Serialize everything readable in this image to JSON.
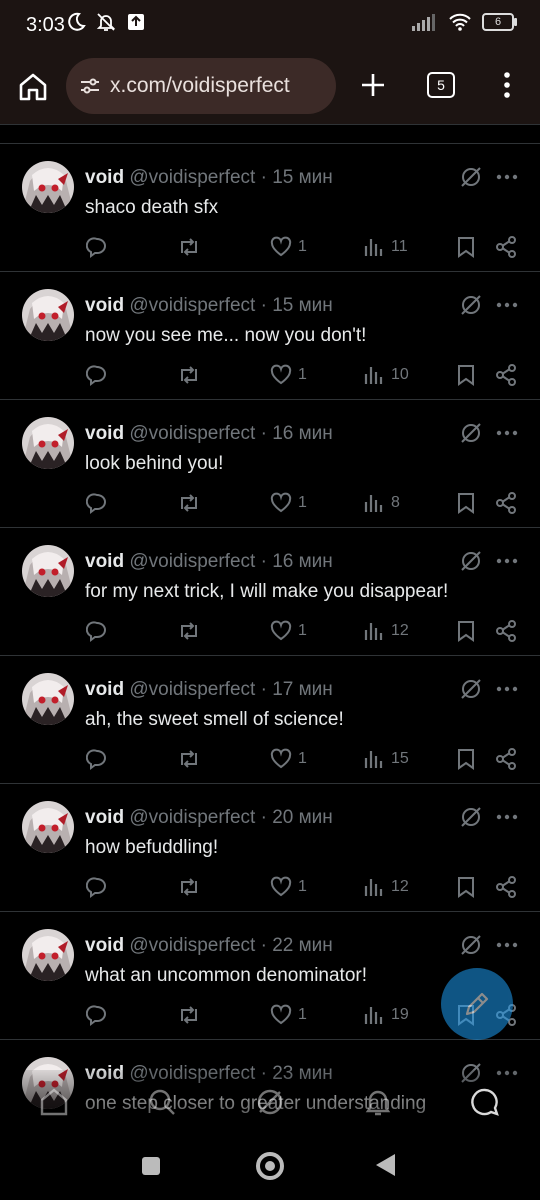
{
  "status_bar": {
    "time": "3:03",
    "battery": "6"
  },
  "browser": {
    "url": "x.com/voidisperfect",
    "tab_count": "5"
  },
  "tweets": [
    {
      "name": "void",
      "handle": "@voidisperfect",
      "time": "15 мин",
      "text": "shaco death sfx",
      "likes": "1",
      "views": "11"
    },
    {
      "name": "void",
      "handle": "@voidisperfect",
      "time": "15 мин",
      "text": "now you see me... now you don't!",
      "likes": "1",
      "views": "10"
    },
    {
      "name": "void",
      "handle": "@voidisperfect",
      "time": "16 мин",
      "text": "look behind you!",
      "likes": "1",
      "views": "8"
    },
    {
      "name": "void",
      "handle": "@voidisperfect",
      "time": "16 мин",
      "text": "for my next trick, I will make you disappear!",
      "likes": "1",
      "views": "12"
    },
    {
      "name": "void",
      "handle": "@voidisperfect",
      "time": "17 мин",
      "text": "ah, the sweet smell of science!",
      "likes": "1",
      "views": "15"
    },
    {
      "name": "void",
      "handle": "@voidisperfect",
      "time": "20 мин",
      "text": "how befuddling!",
      "likes": "1",
      "views": "12"
    },
    {
      "name": "void",
      "handle": "@voidisperfect",
      "time": "22 мин",
      "text": "what an uncommon denominator!",
      "likes": "1",
      "views": "19"
    },
    {
      "name": "void",
      "handle": "@voidisperfect",
      "time": "23 мин",
      "text": "one step closer to greater understanding",
      "likes": "",
      "views": ""
    }
  ],
  "icons": {
    "reply": "reply-icon",
    "retweet": "retweet-icon",
    "like": "heart-icon",
    "views": "views-icon",
    "bookmark": "bookmark-icon",
    "share": "share-icon",
    "grok": "grok-icon",
    "more": "more-icon",
    "compose": "compose-icon"
  },
  "colors": {
    "background": "#000000",
    "browser_chrome": "#1c1412",
    "url_pill": "#3c2a27",
    "accent": "#1d9bf0",
    "muted": "#71767b"
  }
}
